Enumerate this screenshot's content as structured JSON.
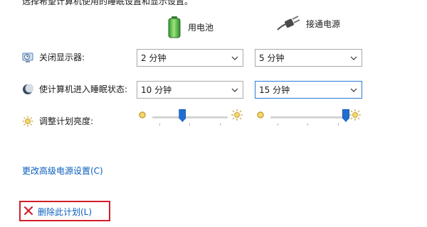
{
  "intro_text": "选择希望计算机使用的睡眠设置和显示设置。",
  "columns": {
    "battery_label": "用电池",
    "plugged_label": "接通电源"
  },
  "rows": {
    "display_off": {
      "label": "关闭显示器:",
      "battery_value": "2 分钟",
      "plugged_value": "5 分钟"
    },
    "sleep": {
      "label": "使计算机进入睡眠状态:",
      "battery_value": "10 分钟",
      "plugged_value": "15 分钟"
    },
    "brightness": {
      "label": "调整计划亮度:",
      "battery_level_percent": 40,
      "plugged_level_percent": 100
    }
  },
  "links": {
    "advanced_settings": "更改高级电源设置(C)",
    "delete_plan": "删除此计划(L)"
  },
  "colors": {
    "link": "#0a5ebe",
    "focus_border": "#2a7ad6",
    "highlight_box": "#d21f2a",
    "slider_thumb": "#1f6fd1"
  }
}
